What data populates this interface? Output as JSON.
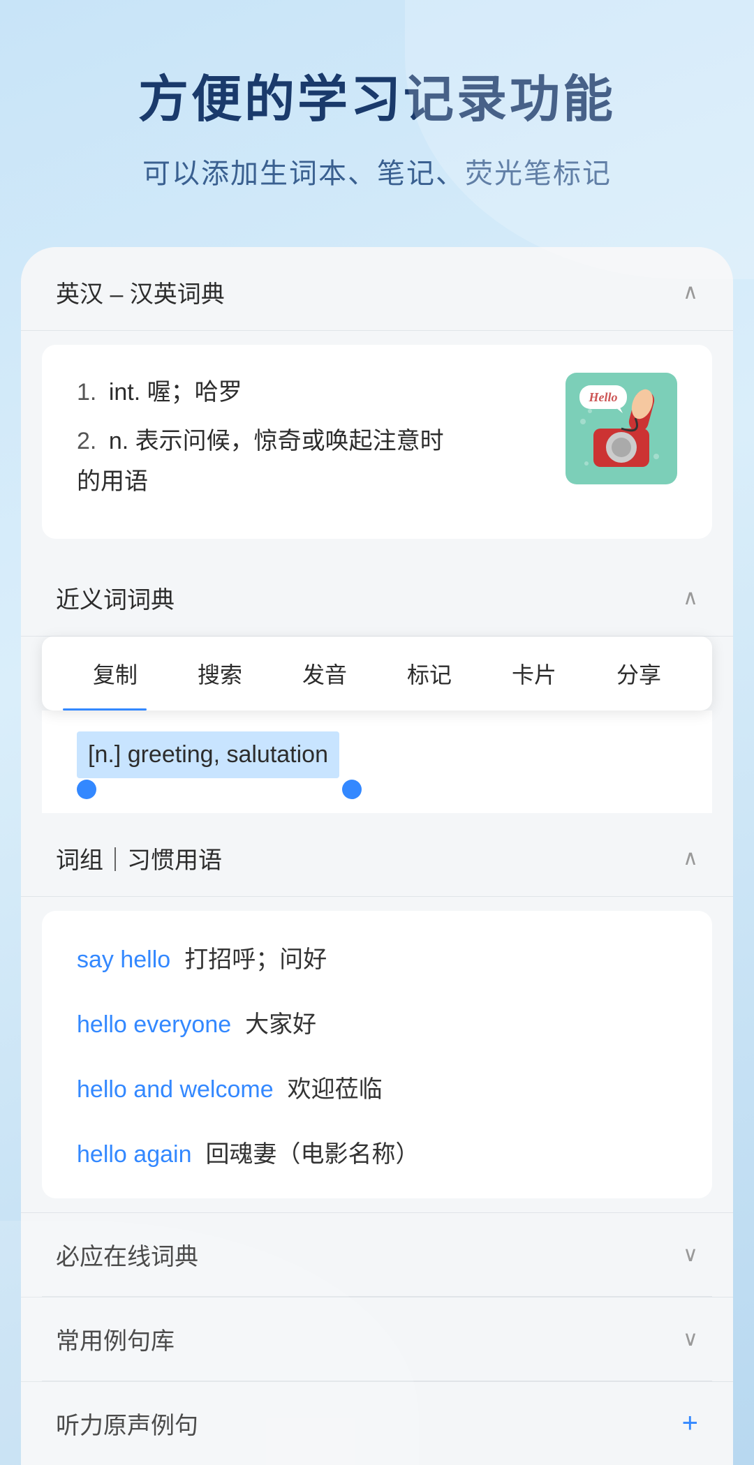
{
  "header": {
    "title": "方便的学习记录功能",
    "subtitle": "可以添加生词本、笔记、荧光笔标记"
  },
  "english_chinese_dict": {
    "section_label": "英汉 – 汉英词典",
    "chevron": "∧",
    "definitions": [
      {
        "number": "1.",
        "pos": "int.",
        "meaning": "喔；哈罗"
      },
      {
        "number": "2.",
        "pos": "n.",
        "meaning": "表示问候，惊奇或唤起注意时的用语"
      }
    ],
    "image_alt": "Hello telephone illustration",
    "image_hello_text": "Hello"
  },
  "synonyms_dict": {
    "section_label": "近义词词典",
    "chevron": "∧",
    "context_menu": {
      "items": [
        "复制",
        "搜索",
        "发音",
        "标记",
        "卡片",
        "分享"
      ]
    },
    "highlighted_content": "[n.] greeting, salutation"
  },
  "phrases_section": {
    "section_label": "词组｜习惯用语",
    "chevron": "∧",
    "phrases": [
      {
        "en": "say hello",
        "zh": "打招呼；问好"
      },
      {
        "en": "hello everyone",
        "zh": "大家好"
      },
      {
        "en": "hello and welcome",
        "zh": "欢迎莅临"
      },
      {
        "en": "hello again",
        "zh": "回魂妻（电影名称）"
      }
    ]
  },
  "other_sections": [
    {
      "label": "必应在线词典",
      "icon": "chevron-down",
      "has_plus": false
    },
    {
      "label": "常用例句库",
      "icon": "chevron-down",
      "has_plus": false
    },
    {
      "label": "听力原声例句",
      "icon": "plus",
      "has_plus": true
    }
  ],
  "icons": {
    "chevron_up": "∧",
    "chevron_down": "∨",
    "plus": "+"
  }
}
